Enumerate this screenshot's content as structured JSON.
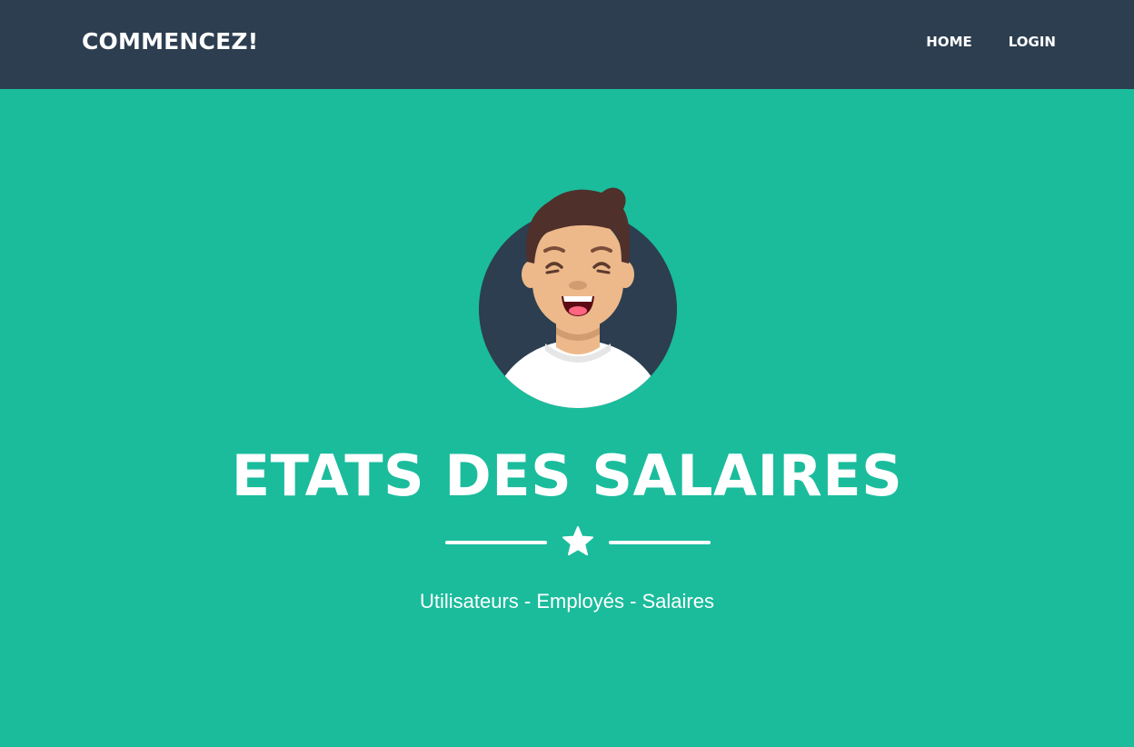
{
  "navbar": {
    "brand": "COMMENCEZ!",
    "links": [
      {
        "label": "HOME"
      },
      {
        "label": "LOGIN"
      }
    ]
  },
  "masthead": {
    "avatar_icon": "smiling-man-avatar-icon",
    "title": "ETATS DES SALAIRES",
    "divider_icon": "star-icon",
    "subtitle": "Utilisateurs - Employés - Salaires"
  },
  "colors": {
    "navbar_bg": "#2c3e50",
    "masthead_bg": "#1abc9c",
    "text": "#ffffff"
  }
}
